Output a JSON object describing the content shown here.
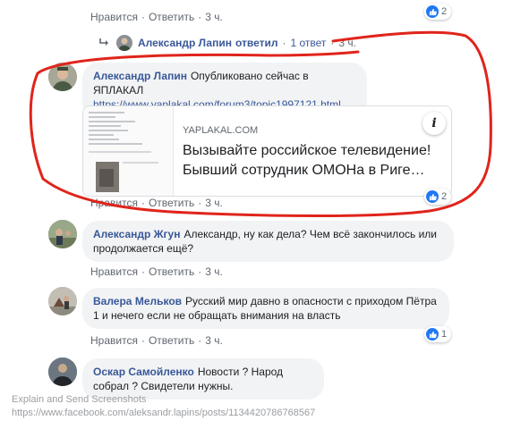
{
  "top_actions": {
    "like": "Нравится",
    "reply": "Ответить",
    "time": "3 ч.",
    "reactions": "2"
  },
  "reply_summary": {
    "author": "Александр Лапин",
    "text": "ответил",
    "count": "1 ответ",
    "time": "3 ч."
  },
  "comments": [
    {
      "author": "Александр Лапин",
      "text": "Опубликовано сейчас в ЯПЛАКАЛ",
      "link": "https://www.yaplakal.com/forum3/topic1997121.html",
      "preview": {
        "domain": "YAPLAKAL.COM",
        "title": "Вызывайте российское телевидение! Бывший сотрудник ОМОНа в Риге…",
        "info": "i"
      },
      "reactions": "2",
      "actions": {
        "like": "Нравится",
        "reply": "Ответить",
        "time": "3 ч."
      }
    },
    {
      "author": "Александр Жгун",
      "text": "Александр, ну как дела? Чем всё закончилось или продолжается ещё?",
      "actions": {
        "like": "Нравится",
        "reply": "Ответить",
        "time": "3 ч."
      }
    },
    {
      "author": "Валера Мельков",
      "text": "Русский мир давно в опасности с приходом Пётра 1 и нечего если не обращать внимания на власть",
      "reactions": "1",
      "actions": {
        "like": "Нравится",
        "reply": "Ответить",
        "time": "3 ч."
      }
    },
    {
      "author": "Оскар Самойленко",
      "text": "Новости ? Народ собрал ? Свидетели нужны."
    }
  ],
  "watermark": {
    "line1": "Explain and Send Screenshots",
    "line2": "https://www.facebook.com/aleksandr.lapins/posts/1134420786768567"
  },
  "colors": {
    "link": "#385898",
    "like": "#2078f4",
    "annotation": "#e0241b",
    "bubble": "#f2f3f5"
  }
}
